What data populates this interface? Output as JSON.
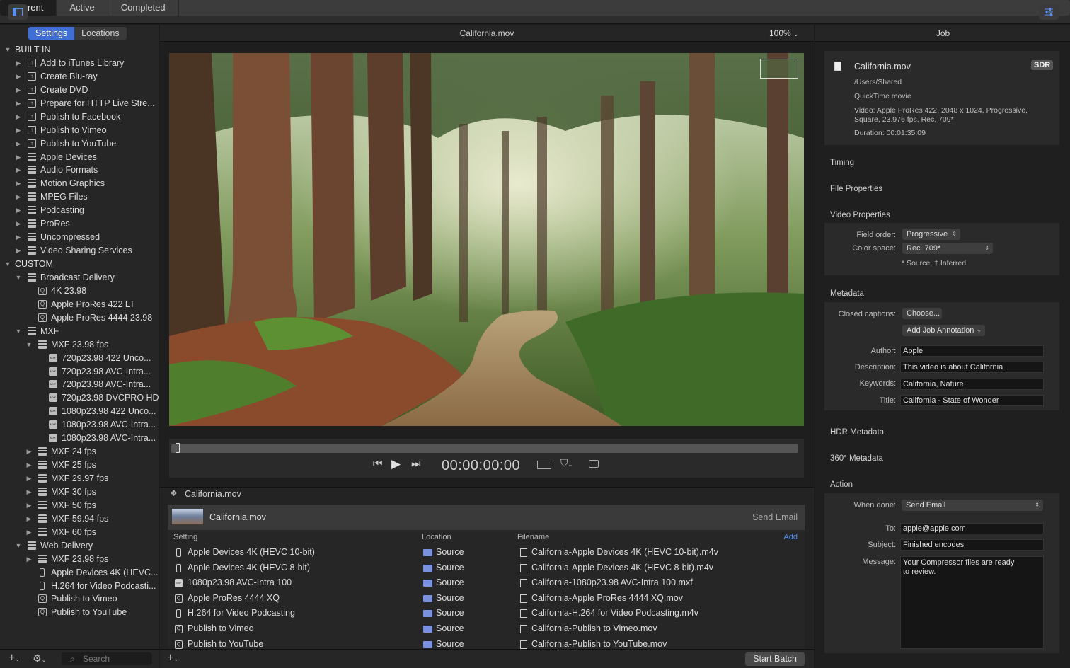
{
  "toolbar": {
    "tabs": [
      "Current",
      "Active",
      "Completed"
    ],
    "selected": "Current"
  },
  "left": {
    "tabs": [
      "Settings",
      "Locations"
    ],
    "tree": [
      {
        "label": "BUILT-IN",
        "level": 0,
        "tri": "open",
        "icon": "none"
      },
      {
        "label": "Add to iTunes Library",
        "level": 1,
        "tri": "closed",
        "icon": "share"
      },
      {
        "label": "Create Blu-ray",
        "level": 1,
        "tri": "closed",
        "icon": "share"
      },
      {
        "label": "Create DVD",
        "level": 1,
        "tri": "closed",
        "icon": "share"
      },
      {
        "label": "Prepare for HTTP Live Stre...",
        "level": 1,
        "tri": "closed",
        "icon": "share"
      },
      {
        "label": "Publish to Facebook",
        "level": 1,
        "tri": "closed",
        "icon": "share"
      },
      {
        "label": "Publish to Vimeo",
        "level": 1,
        "tri": "closed",
        "icon": "share"
      },
      {
        "label": "Publish to YouTube",
        "level": 1,
        "tri": "closed",
        "icon": "share"
      },
      {
        "label": "Apple Devices",
        "level": 1,
        "tri": "closed",
        "icon": "stack"
      },
      {
        "label": "Audio Formats",
        "level": 1,
        "tri": "closed",
        "icon": "stack"
      },
      {
        "label": "Motion Graphics",
        "level": 1,
        "tri": "closed",
        "icon": "stack"
      },
      {
        "label": "MPEG Files",
        "level": 1,
        "tri": "closed",
        "icon": "stack"
      },
      {
        "label": "Podcasting",
        "level": 1,
        "tri": "closed",
        "icon": "stack"
      },
      {
        "label": "ProRes",
        "level": 1,
        "tri": "closed",
        "icon": "stack"
      },
      {
        "label": "Uncompressed",
        "level": 1,
        "tri": "closed",
        "icon": "stack"
      },
      {
        "label": "Video Sharing Services",
        "level": 1,
        "tri": "closed",
        "icon": "stack"
      },
      {
        "label": "CUSTOM",
        "level": 0,
        "tri": "open",
        "icon": "none"
      },
      {
        "label": "Broadcast Delivery",
        "level": 1,
        "tri": "open",
        "icon": "stack"
      },
      {
        "label": "4K 23.98",
        "level": 2,
        "tri": "none",
        "icon": "q"
      },
      {
        "label": "Apple ProRes 422 LT",
        "level": 2,
        "tri": "none",
        "icon": "q"
      },
      {
        "label": "Apple ProRes 4444 23.98",
        "level": 2,
        "tri": "none",
        "icon": "q"
      },
      {
        "label": "MXF",
        "level": 1,
        "tri": "open",
        "icon": "stack"
      },
      {
        "label": "MXF 23.98 fps",
        "level": 2,
        "tri": "open",
        "icon": "stack"
      },
      {
        "label": "720p23.98 422 Unco...",
        "level": 3,
        "tri": "none",
        "icon": "mxf"
      },
      {
        "label": "720p23.98 AVC-Intra...",
        "level": 3,
        "tri": "none",
        "icon": "mxf"
      },
      {
        "label": "720p23.98 AVC-Intra...",
        "level": 3,
        "tri": "none",
        "icon": "mxf"
      },
      {
        "label": "720p23.98 DVCPRO HD",
        "level": 3,
        "tri": "none",
        "icon": "mxf"
      },
      {
        "label": "1080p23.98 422 Unco...",
        "level": 3,
        "tri": "none",
        "icon": "mxf"
      },
      {
        "label": "1080p23.98 AVC-Intra...",
        "level": 3,
        "tri": "none",
        "icon": "mxf"
      },
      {
        "label": "1080p23.98 AVC-Intra...",
        "level": 3,
        "tri": "none",
        "icon": "mxf"
      },
      {
        "label": "MXF 24 fps",
        "level": 2,
        "tri": "closed",
        "icon": "stack"
      },
      {
        "label": "MXF 25 fps",
        "level": 2,
        "tri": "closed",
        "icon": "stack"
      },
      {
        "label": "MXF 29.97 fps",
        "level": 2,
        "tri": "closed",
        "icon": "stack"
      },
      {
        "label": "MXF 30 fps",
        "level": 2,
        "tri": "closed",
        "icon": "stack"
      },
      {
        "label": "MXF 50 fps",
        "level": 2,
        "tri": "closed",
        "icon": "stack"
      },
      {
        "label": "MXF 59.94 fps",
        "level": 2,
        "tri": "closed",
        "icon": "stack"
      },
      {
        "label": "MXF 60 fps",
        "level": 2,
        "tri": "closed",
        "icon": "stack"
      },
      {
        "label": "Web Delivery",
        "level": 1,
        "tri": "open",
        "icon": "stack"
      },
      {
        "label": "MXF 23.98 fps",
        "level": 2,
        "tri": "closed",
        "icon": "stack"
      },
      {
        "label": "Apple Devices 4K (HEVC...",
        "level": 2,
        "tri": "none",
        "icon": "phone"
      },
      {
        "label": "H.264 for Video Podcasti...",
        "level": 2,
        "tri": "none",
        "icon": "phone"
      },
      {
        "label": "Publish to Vimeo",
        "level": 2,
        "tri": "none",
        "icon": "q"
      },
      {
        "label": "Publish to YouTube",
        "level": 2,
        "tri": "none",
        "icon": "q"
      }
    ],
    "search_placeholder": "Search"
  },
  "center": {
    "filename": "California.mov",
    "zoom": "100%",
    "timecode": "00:00:00:00",
    "batch_title": "California.mov",
    "job_name": "California.mov",
    "job_action": "Send Email",
    "columns": {
      "setting": "Setting",
      "location": "Location",
      "filename": "Filename",
      "add": "Add"
    },
    "rows": [
      {
        "setting": "Apple Devices 4K (HEVC 10-bit)",
        "icon": "phone",
        "location": "Source",
        "filename": "California-Apple Devices 4K (HEVC 10-bit).m4v"
      },
      {
        "setting": "Apple Devices 4K (HEVC 8-bit)",
        "icon": "phone",
        "location": "Source",
        "filename": "California-Apple Devices 4K (HEVC 8-bit).m4v"
      },
      {
        "setting": "1080p23.98 AVC-Intra 100",
        "icon": "mxf",
        "location": "Source",
        "filename": "California-1080p23.98 AVC-Intra 100.mxf"
      },
      {
        "setting": "Apple ProRes 4444 XQ",
        "icon": "q",
        "location": "Source",
        "filename": "California-Apple ProRes 4444 XQ.mov"
      },
      {
        "setting": "H.264 for Video Podcasting",
        "icon": "phone",
        "location": "Source",
        "filename": "California-H.264 for Video Podcasting.m4v"
      },
      {
        "setting": "Publish to Vimeo",
        "icon": "q",
        "location": "Source",
        "filename": "California-Publish to Vimeo.mov"
      },
      {
        "setting": "Publish to YouTube",
        "icon": "q",
        "location": "Source",
        "filename": "California-Publish to YouTube.mov"
      }
    ],
    "start_batch": "Start Batch"
  },
  "right": {
    "header": "Job",
    "file": {
      "name": "California.mov",
      "badge": "SDR",
      "path": "/Users/Shared",
      "kind": "QuickTime movie",
      "video_line1": "Video: Apple ProRes 422, 2048 x 1024, Progressive,",
      "video_line2": "Square, 23.976 fps, Rec. 709*",
      "duration": "Duration: 00:01:35:09"
    },
    "sections": {
      "timing": "Timing",
      "file_properties": "File Properties",
      "video_properties": "Video Properties",
      "metadata": "Metadata",
      "hdr_metadata": "HDR Metadata",
      "metadata_360": "360° Metadata",
      "action": "Action"
    },
    "video": {
      "field_order_label": "Field order:",
      "field_order_value": "Progressive",
      "color_space_label": "Color space:",
      "color_space_value": "Rec. 709*",
      "note": "* Source, † Inferred"
    },
    "meta": {
      "captions_label": "Closed captions:",
      "captions_button": "Choose...",
      "annotation_button": "Add Job Annotation",
      "author_label": "Author:",
      "author": "Apple",
      "description_label": "Description:",
      "description": "This video is about California",
      "keywords_label": "Keywords:",
      "keywords": "California, Nature",
      "title_label": "Title:",
      "title": "California - State of Wonder"
    },
    "action": {
      "when_done_label": "When done:",
      "when_done": "Send Email",
      "to_label": "To:",
      "to": "apple@apple.com",
      "subject_label": "Subject:",
      "subject": "Finished encodes",
      "message_label": "Message:",
      "message": "Your Compressor files are ready to review."
    }
  },
  "colors": {
    "accent": "#3f6fd6",
    "folder": "#7a90e0",
    "link": "#4d8bf0"
  }
}
